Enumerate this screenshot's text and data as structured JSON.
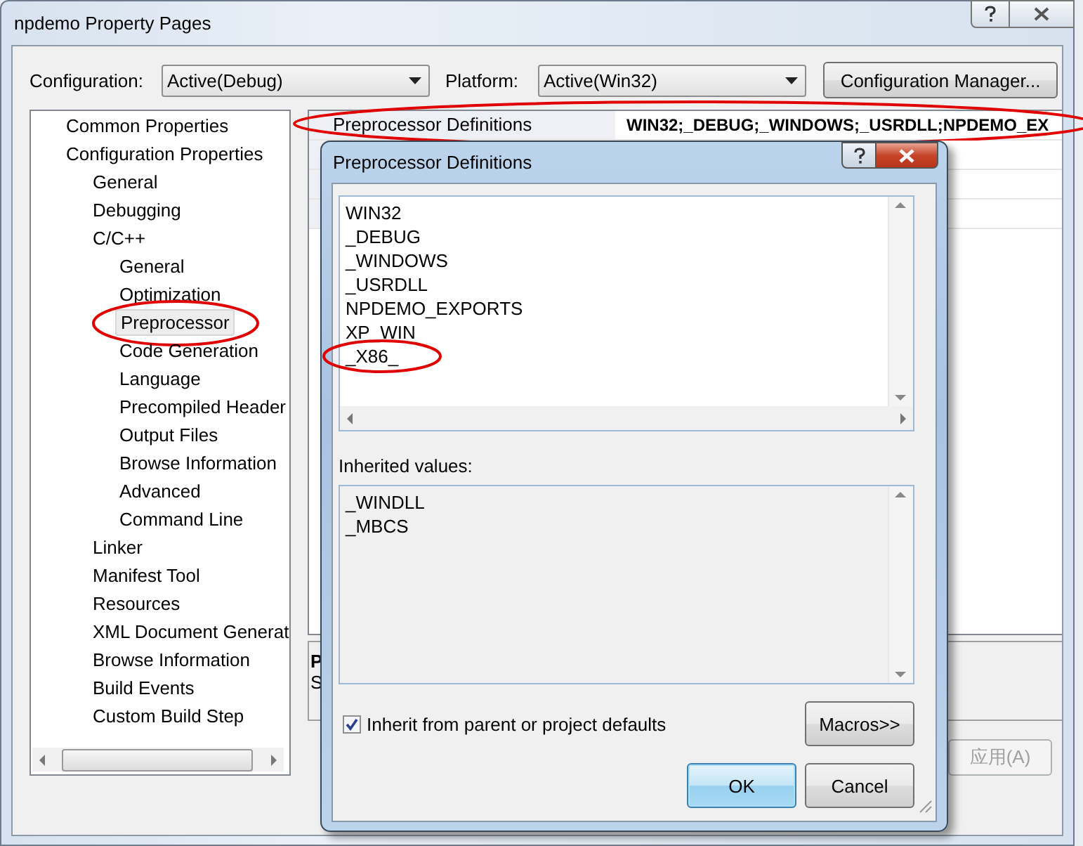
{
  "window": {
    "title": "npdemo Property Pages"
  },
  "configuration": {
    "label": "Configuration:",
    "value": "Active(Debug)"
  },
  "platform": {
    "label": "Platform:",
    "value": "Active(Win32)"
  },
  "config_manager_button": {
    "label": "Configuration Manager..."
  },
  "tree": [
    {
      "label": "Common Properties",
      "selected": false,
      "circled": false
    },
    {
      "label": "Configuration Properties",
      "selected": false,
      "circled": false,
      "children": [
        {
          "label": "General",
          "selected": false,
          "circled": false
        },
        {
          "label": "Debugging",
          "selected": false,
          "circled": false
        },
        {
          "label": "C/C++",
          "selected": false,
          "circled": false,
          "children": [
            {
              "label": "General",
              "selected": false,
              "circled": false
            },
            {
              "label": "Optimization",
              "selected": false,
              "circled": false
            },
            {
              "label": "Preprocessor",
              "selected": true,
              "circled": true
            },
            {
              "label": "Code Generation",
              "selected": false,
              "circled": false
            },
            {
              "label": "Language",
              "selected": false,
              "circled": false
            },
            {
              "label": "Precompiled Header",
              "selected": false,
              "circled": false
            },
            {
              "label": "Output Files",
              "selected": false,
              "circled": false
            },
            {
              "label": "Browse Information",
              "selected": false,
              "circled": false
            },
            {
              "label": "Advanced",
              "selected": false,
              "circled": false
            },
            {
              "label": "Command Line",
              "selected": false,
              "circled": false
            }
          ]
        },
        {
          "label": "Linker",
          "selected": false,
          "circled": false
        },
        {
          "label": "Manifest Tool",
          "selected": false,
          "circled": false
        },
        {
          "label": "Resources",
          "selected": false,
          "circled": false
        },
        {
          "label": "XML Document Generat",
          "selected": false,
          "circled": false
        },
        {
          "label": "Browse Information",
          "selected": false,
          "circled": false
        },
        {
          "label": "Build Events",
          "selected": false,
          "circled": false
        },
        {
          "label": "Custom Build Step",
          "selected": false,
          "circled": false
        }
      ]
    }
  ],
  "property_grid": {
    "rows": [
      {
        "name": "Preprocessor Definitions",
        "value": "WIN32;_DEBUG;_WINDOWS;_USRDLL;NPDEMO_EX",
        "circled": true
      }
    ]
  },
  "description": {
    "title": "P",
    "text": "S"
  },
  "apply_button": {
    "label": "应用(A)",
    "disabled": true
  },
  "dialog": {
    "title": "Preprocessor Definitions",
    "values": [
      {
        "text": "WIN32",
        "circled": false
      },
      {
        "text": "_DEBUG",
        "circled": false
      },
      {
        "text": "_WINDOWS",
        "circled": false
      },
      {
        "text": "_USRDLL",
        "circled": false
      },
      {
        "text": "NPDEMO_EXPORTS",
        "circled": false
      },
      {
        "text": "XP_WIN",
        "circled": false
      },
      {
        "text": "_X86_",
        "circled": true
      }
    ],
    "inherited_label": "Inherited values:",
    "inherited_values": [
      "_WINDLL",
      "_MBCS"
    ],
    "inherit_checkbox": {
      "label": "Inherit from parent or project defaults",
      "checked": true
    },
    "buttons": [
      {
        "label": "Macros>>",
        "kind": "macros"
      },
      {
        "label": "OK",
        "kind": "default"
      },
      {
        "label": "Cancel",
        "kind": "plain"
      }
    ]
  }
}
